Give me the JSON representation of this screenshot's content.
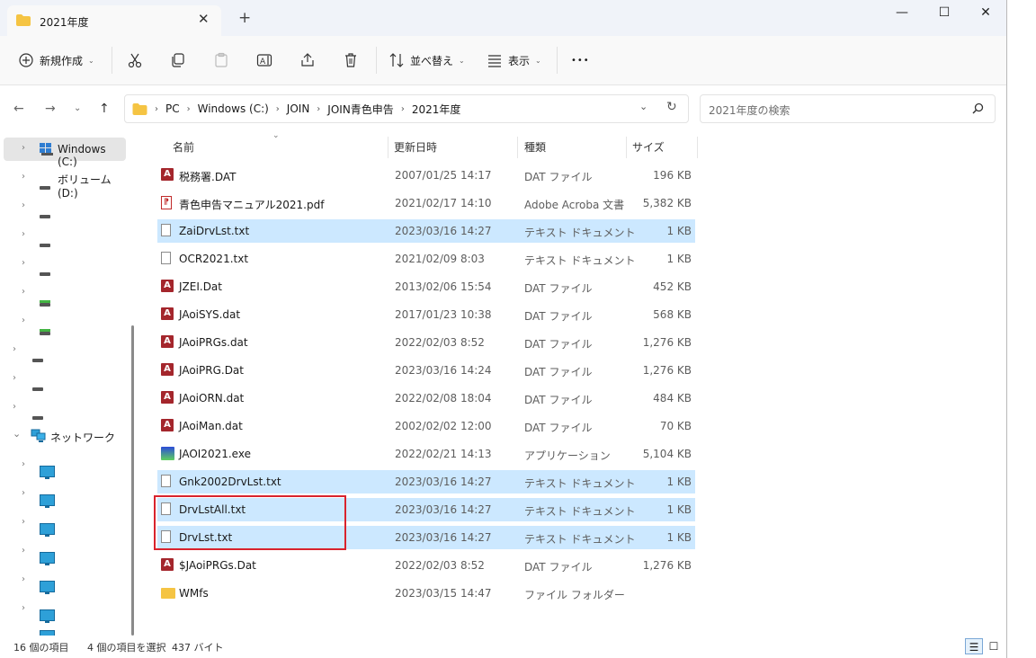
{
  "window": {
    "tab_title": "2021年度",
    "tab_close": "✕",
    "new_tab": "+",
    "minimize": "—",
    "maximize": "☐",
    "close": "✕"
  },
  "toolbar": {
    "new_label": "新規作成",
    "sort_label": "並べ替え",
    "view_label": "表示",
    "more_label": "•••"
  },
  "address": {
    "crumbs": [
      "PC",
      "Windows (C:)",
      "JOIN",
      "JOIN青色申告",
      "2021年度"
    ],
    "search_placeholder": "2021年度の検索"
  },
  "nav": {
    "items": [
      {
        "label": "Windows (C:)",
        "icon": "windows-drive-icon"
      },
      {
        "label": "ボリューム (D:)",
        "icon": "drive-icon"
      },
      {
        "label": "",
        "icon": "drive-icon"
      },
      {
        "label": "",
        "icon": "drive-icon"
      },
      {
        "label": "",
        "icon": "drive-icon"
      },
      {
        "label": "",
        "icon": "green-drive-icon"
      },
      {
        "label": "",
        "icon": "green-drive-icon"
      },
      {
        "label": "",
        "icon": "drive-icon"
      },
      {
        "label": "",
        "icon": "drive-icon"
      },
      {
        "label": "",
        "icon": "drive-icon"
      },
      {
        "label": "ネットワーク",
        "icon": "network-icon"
      }
    ]
  },
  "columns": {
    "name": "名前",
    "date": "更新日時",
    "type": "種類",
    "size": "サイズ"
  },
  "files": [
    {
      "name": "税務署.DAT",
      "date": "2007/01/25 14:17",
      "type": "DAT ファイル",
      "size": "196 KB",
      "icon": "access-icon",
      "selected": false
    },
    {
      "name": "青色申告マニュアル2021.pdf",
      "date": "2021/02/17 14:10",
      "type": "Adobe Acroba 文書",
      "size": "5,382 KB",
      "icon": "pdf-icon",
      "selected": false
    },
    {
      "name": "ZaiDrvLst.txt",
      "date": "2023/03/16 14:27",
      "type": "テキスト ドキュメント",
      "size": "1 KB",
      "icon": "text-file-icon",
      "selected": true
    },
    {
      "name": "OCR2021.txt",
      "date": "2021/02/09 8:03",
      "type": "テキスト ドキュメント",
      "size": "1 KB",
      "icon": "text-file-icon",
      "selected": false
    },
    {
      "name": "JZEI.Dat",
      "date": "2013/02/06 15:54",
      "type": "DAT ファイル",
      "size": "452 KB",
      "icon": "access-icon",
      "selected": false
    },
    {
      "name": "JAoiSYS.dat",
      "date": "2017/01/23 10:38",
      "type": "DAT ファイル",
      "size": "568 KB",
      "icon": "access-icon",
      "selected": false
    },
    {
      "name": "JAoiPRGs.dat",
      "date": "2022/02/03 8:52",
      "type": "DAT ファイル",
      "size": "1,276 KB",
      "icon": "access-icon",
      "selected": false
    },
    {
      "name": "JAoiPRG.Dat",
      "date": "2023/03/16 14:24",
      "type": "DAT ファイル",
      "size": "1,276 KB",
      "icon": "access-icon",
      "selected": false
    },
    {
      "name": "JAoiORN.dat",
      "date": "2022/02/08 18:04",
      "type": "DAT ファイル",
      "size": "484 KB",
      "icon": "access-icon",
      "selected": false
    },
    {
      "name": "JAoiMan.dat",
      "date": "2002/02/02 12:00",
      "type": "DAT ファイル",
      "size": "70 KB",
      "icon": "access-icon",
      "selected": false
    },
    {
      "name": "JAOI2021.exe",
      "date": "2022/02/21 14:13",
      "type": "アプリケーション",
      "size": "5,104 KB",
      "icon": "exe-icon",
      "selected": false
    },
    {
      "name": "Gnk2002DrvLst.txt",
      "date": "2023/03/16 14:27",
      "type": "テキスト ドキュメント",
      "size": "1 KB",
      "icon": "text-file-icon",
      "selected": true
    },
    {
      "name": "DrvLstAll.txt",
      "date": "2023/03/16 14:27",
      "type": "テキスト ドキュメント",
      "size": "1 KB",
      "icon": "text-file-icon",
      "selected": true
    },
    {
      "name": "DrvLst.txt",
      "date": "2023/03/16 14:27",
      "type": "テキスト ドキュメント",
      "size": "1 KB",
      "icon": "text-file-icon",
      "selected": true
    },
    {
      "name": "$JAoiPRGs.Dat",
      "date": "2022/02/03 8:52",
      "type": "DAT ファイル",
      "size": "1,276 KB",
      "icon": "access-icon",
      "selected": false
    },
    {
      "name": "WMfs",
      "date": "2023/03/15 14:47",
      "type": "ファイル フォルダー",
      "size": "",
      "icon": "folder-icon",
      "selected": false
    }
  ],
  "status": {
    "item_count": "16 個の項目",
    "selection": "4 個の項目を選択",
    "selection_size": "437 バイト"
  },
  "colors": {
    "selection": "#cce8ff",
    "highlight_box": "#d9232d",
    "tabbar": "#f0f3f9"
  }
}
